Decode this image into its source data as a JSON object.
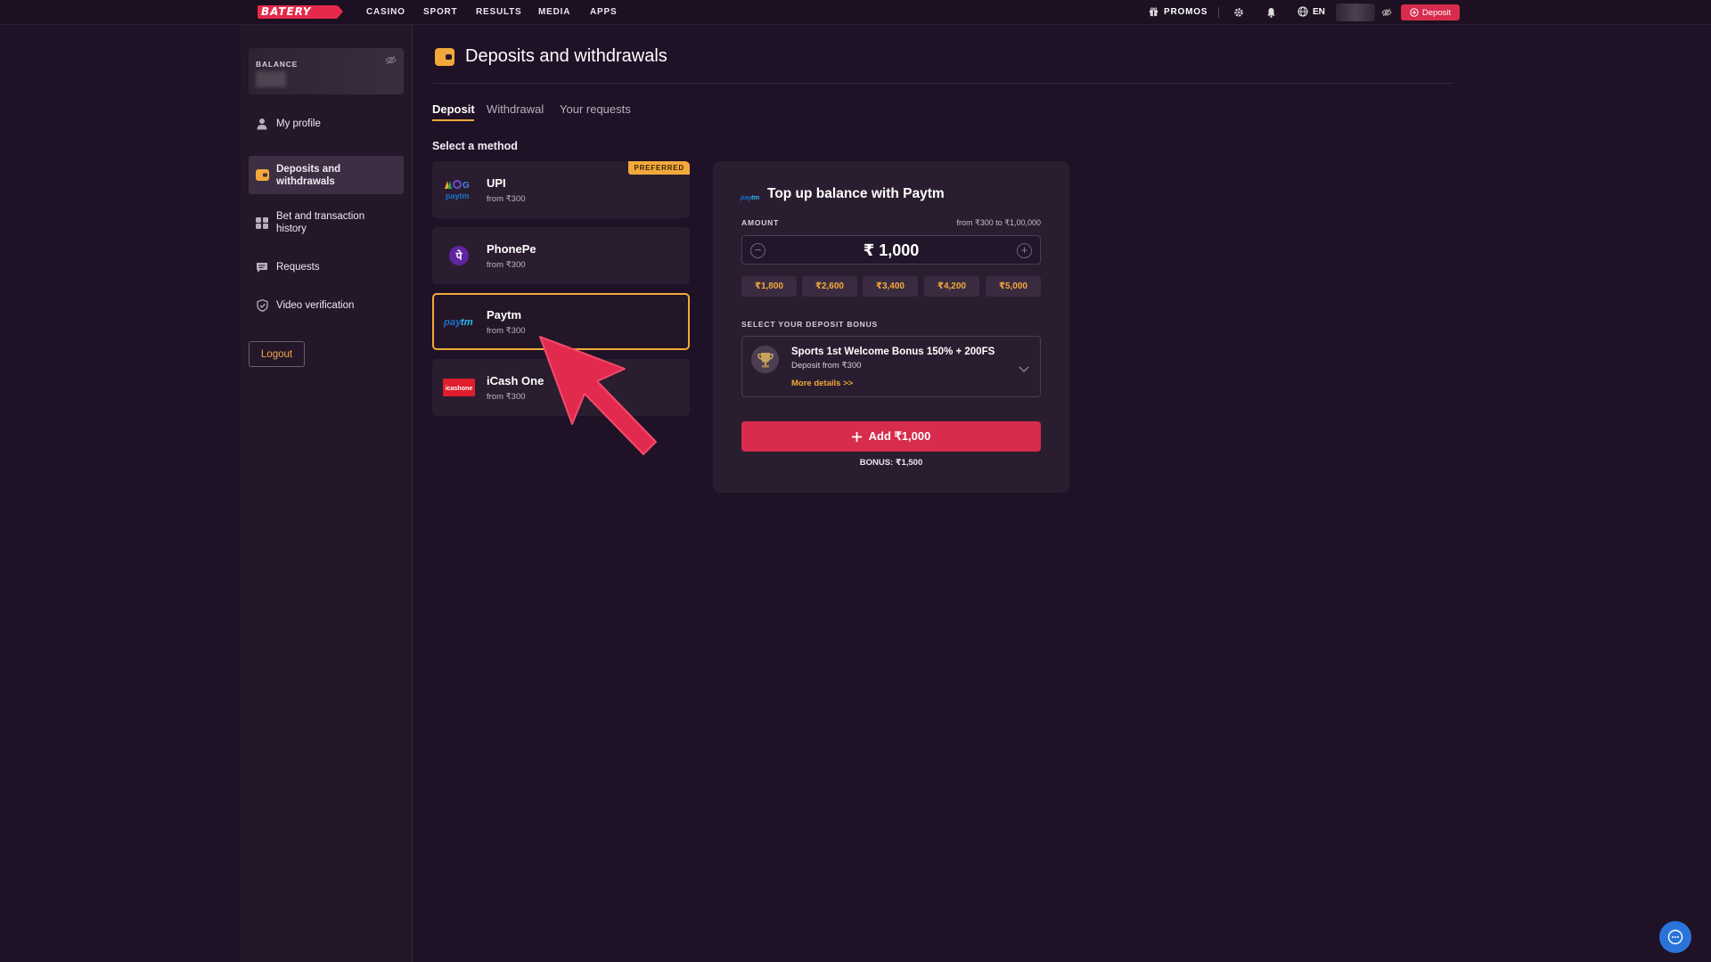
{
  "topbar": {
    "logo": "BATERY",
    "nav": [
      "CASINO",
      "SPORT",
      "RESULTS",
      "MEDIA",
      "APPS"
    ],
    "promos": "PROMOS",
    "lang": "EN",
    "deposit": "Deposit"
  },
  "sidebar": {
    "balance_label": "BALANCE",
    "items": [
      {
        "label": "My profile",
        "icon": "user-icon"
      },
      {
        "label": "Deposits and withdrawals",
        "icon": "wallet-icon"
      },
      {
        "label": "Bet and transaction history",
        "icon": "history-icon"
      },
      {
        "label": "Requests",
        "icon": "chat-icon"
      },
      {
        "label": "Video verification",
        "icon": "shield-icon"
      }
    ],
    "logout": "Logout"
  },
  "main": {
    "title": "Deposits and withdrawals",
    "tabs": [
      "Deposit",
      "Withdrawal",
      "Your requests"
    ],
    "select_method": "Select a method",
    "methods": [
      {
        "name": "UPI",
        "from": "from ₹300",
        "badge": "PREFERRED"
      },
      {
        "name": "PhonePe",
        "from": "from ₹300"
      },
      {
        "name": "Paytm",
        "from": "from ₹300"
      },
      {
        "name": "iCash One",
        "from": "from ₹300"
      }
    ]
  },
  "panel": {
    "title": "Top up balance with Paytm",
    "amount_label": "AMOUNT",
    "amount_range": "from ₹300 to ₹1,00,000",
    "amount_value": "₹ 1,000",
    "chips": [
      "₹1,800",
      "₹2,600",
      "₹3,400",
      "₹4,200",
      "₹5,000"
    ],
    "bonus_label": "SELECT YOUR DEPOSIT BONUS",
    "bonus_title": "Sports 1st Welcome Bonus 150% + 200FS",
    "bonus_sub": "Deposit from ₹300",
    "bonus_more": "More details >>",
    "add_button": "Add ₹1,000",
    "bonus_total": "BONUS: ₹1,500"
  },
  "colors": {
    "background": "#1f1226",
    "accent_orange": "#f2a93b",
    "accent_red": "#d72c4d",
    "annotation_arrow": "#e22a4f"
  }
}
